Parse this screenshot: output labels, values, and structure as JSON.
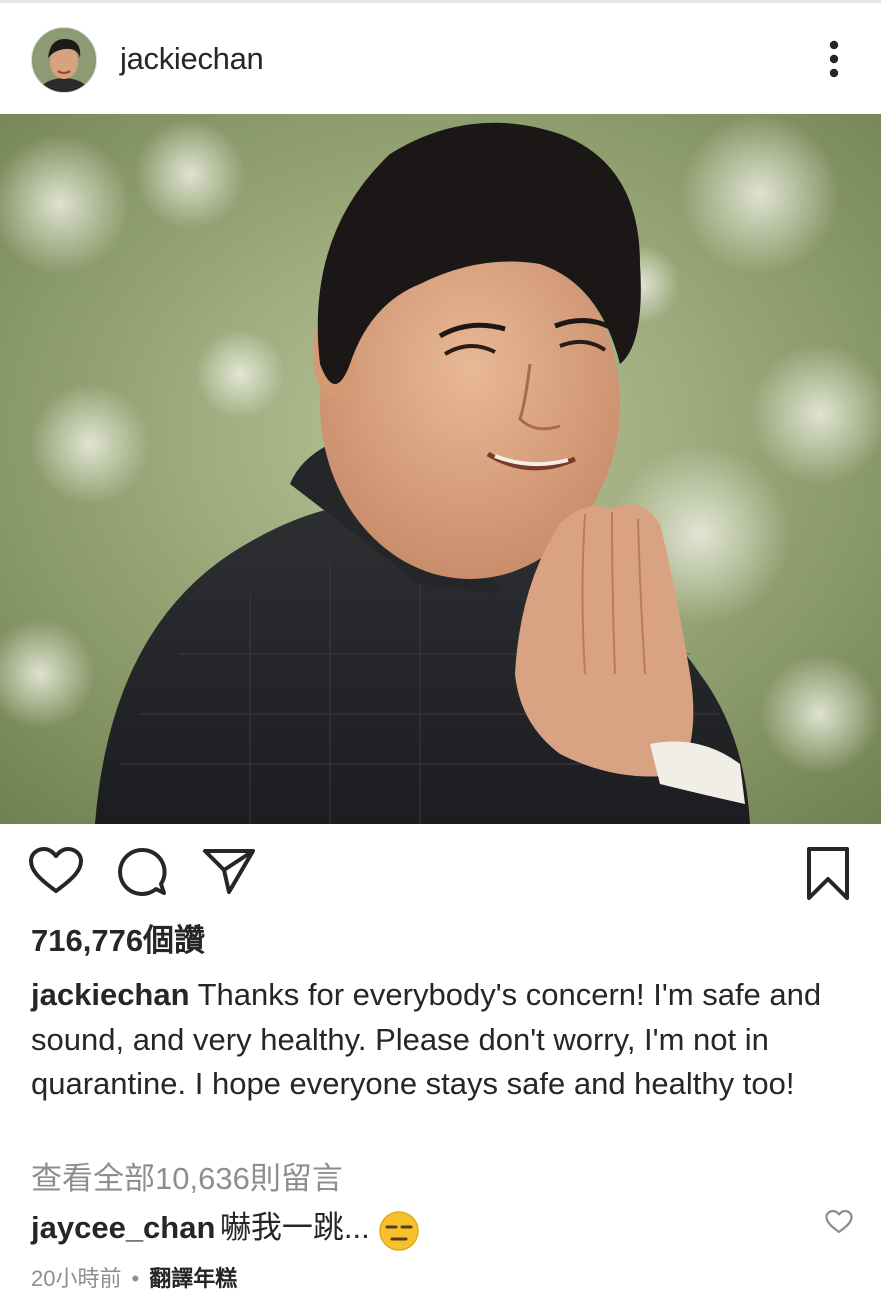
{
  "post": {
    "username": "jackiechan",
    "image_alt": "Jackie Chan smiling with palms pressed together"
  },
  "likes": {
    "text": "716,776個讚"
  },
  "caption": {
    "username": "jackiechan",
    "text": "Thanks for everybody's concern! I'm safe and sound, and very healthy. Please don't worry, I'm not in quarantine. I hope everyone stays safe and healthy too!"
  },
  "view_comments": "查看全部10,636則留言",
  "comment": {
    "username": "jaycee_chan",
    "text": "嚇我一跳...",
    "emoji": "expressionless-face-icon"
  },
  "meta": {
    "time": "20小時前",
    "separator": "•",
    "translate": "翻譯年糕"
  },
  "icons": {
    "like": "heart-outline-icon",
    "comment": "comment-bubble-icon",
    "share": "paper-plane-icon",
    "save": "bookmark-icon",
    "more": "vertical-ellipsis-icon"
  },
  "colors": {
    "text": "#262626",
    "muted": "#8e8e8e",
    "divider": "#e6e6e6"
  }
}
